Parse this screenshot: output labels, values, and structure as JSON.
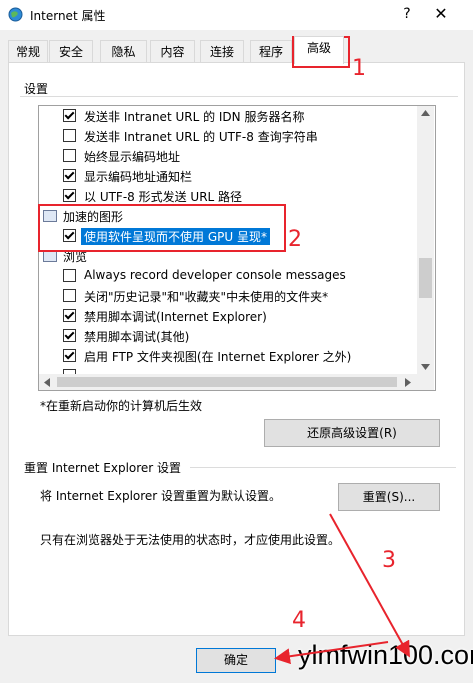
{
  "window": {
    "title": "Internet 属性",
    "help_label": "?",
    "close_label": "✕"
  },
  "tabs": [
    "常规",
    "安全",
    "隐私",
    "内容",
    "连接",
    "程序",
    "高级"
  ],
  "settings_label": "设置",
  "settings_items": [
    {
      "type": "item",
      "text": "发送非 Intranet URL 的 IDN 服务器名称",
      "checked": true
    },
    {
      "type": "item",
      "text": "发送非 Intranet URL 的 UTF-8 查询字符串",
      "checked": false
    },
    {
      "type": "item",
      "text": "始终显示编码地址",
      "checked": false
    },
    {
      "type": "item",
      "text": "显示编码地址通知栏",
      "checked": true
    },
    {
      "type": "item",
      "text": "以 UTF-8 形式发送 URL 路径",
      "checked": true
    },
    {
      "type": "category",
      "text": "加速的图形"
    },
    {
      "type": "item",
      "text": "使用软件呈现而不使用 GPU 呈现*",
      "checked": true,
      "selected": true
    },
    {
      "type": "category",
      "text": "浏览"
    },
    {
      "type": "item",
      "text": "Always record developer console messages",
      "checked": false
    },
    {
      "type": "item",
      "text": "关闭\"历史记录\"和\"收藏夹\"中未使用的文件夹*",
      "checked": false
    },
    {
      "type": "item",
      "text": "禁用脚本调试(Internet Explorer)",
      "checked": true
    },
    {
      "type": "item",
      "text": "禁用脚本调试(其他)",
      "checked": true
    },
    {
      "type": "item",
      "text": "启用 FTP 文件夹视图(在 Internet Explorer 之外)",
      "checked": true
    }
  ],
  "restart_note": "*在重新启动你的计算机后生效",
  "restore_button": "还原高级设置(R)",
  "reset_group_label": "重置 Internet Explorer 设置",
  "reset_desc": "将 Internet Explorer 设置重置为默认设置。",
  "reset_button": "重置(S)...",
  "reset_note": "只有在浏览器处于无法使用的状态时，才应使用此设置。",
  "ok_button": "确定",
  "watermark": "ylmfwin100.com",
  "annotations": [
    "1",
    "2",
    "3",
    "4"
  ],
  "colors": {
    "annotation_red": "#e8242d",
    "selection_blue": "#0078d7"
  }
}
